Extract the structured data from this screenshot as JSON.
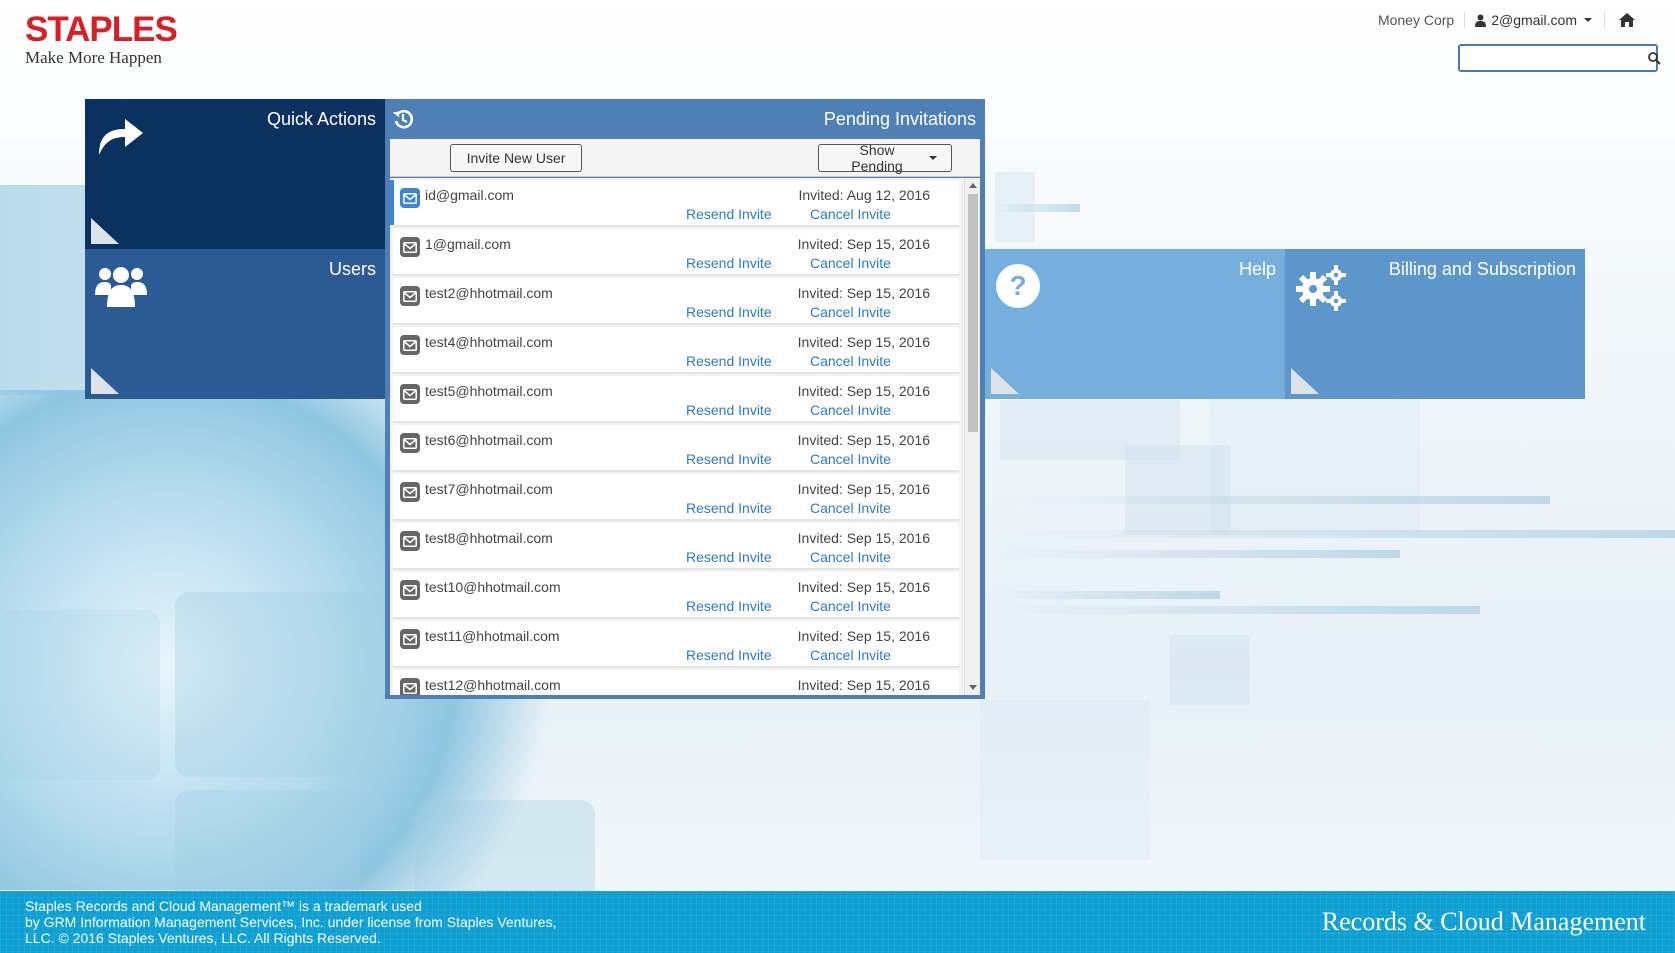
{
  "brand": {
    "logo_word": "STAPLES",
    "tagline": "Make More Happen",
    "logo_color": "#d71f26"
  },
  "topbar": {
    "org_name": "Money Corp",
    "user_email": "2@gmail.com",
    "home_icon": "home-icon",
    "search_placeholder": ""
  },
  "tiles": {
    "quick_actions": {
      "title": "Quick Actions",
      "icon": "share-arrow-icon",
      "color": "#0b3160"
    },
    "users": {
      "title": "Users",
      "icon": "users-group-icon",
      "color": "#2c5b93"
    },
    "help": {
      "title": "Help",
      "icon": "question-circle-icon",
      "color": "#76aedd"
    },
    "billing": {
      "title": "Billing and Subscription",
      "icon": "gears-icon",
      "color": "#5d96cb"
    }
  },
  "pending": {
    "title": "Pending Invitations",
    "icon": "history-icon",
    "invite_button": "Invite New User",
    "filter_button": "Show Pending",
    "resend_label": "Resend Invite",
    "cancel_label": "Cancel Invite",
    "items": [
      {
        "email": "id@gmail.com",
        "invited": "Invited: Aug 12, 2016"
      },
      {
        "email": "1@gmail.com",
        "invited": "Invited: Sep 15, 2016"
      },
      {
        "email": "test2@hhotmail.com",
        "invited": "Invited: Sep 15, 2016"
      },
      {
        "email": "test4@hhotmail.com",
        "invited": "Invited: Sep 15, 2016"
      },
      {
        "email": "test5@hhotmail.com",
        "invited": "Invited: Sep 15, 2016"
      },
      {
        "email": "test6@hhotmail.com",
        "invited": "Invited: Sep 15, 2016"
      },
      {
        "email": "test7@hhotmail.com",
        "invited": "Invited: Sep 15, 2016"
      },
      {
        "email": "test8@hhotmail.com",
        "invited": "Invited: Sep 15, 2016"
      },
      {
        "email": "test10@hhotmail.com",
        "invited": "Invited: Sep 15, 2016"
      },
      {
        "email": "test11@hhotmail.com",
        "invited": "Invited: Sep 15, 2016"
      },
      {
        "email": "test12@hhotmail.com",
        "invited": "Invited: Sep 15, 2016"
      }
    ]
  },
  "footer": {
    "legal_line1": "Staples Records and Cloud Management™ is a trademark used",
    "legal_line2": "by GRM Information Management Services, Inc. under license from Staples Ventures,",
    "legal_line3": "LLC. © 2016 Staples Ventures, LLC. All Rights Reserved.",
    "product_name": "Records & Cloud Management",
    "color": "#0e9fd3"
  }
}
